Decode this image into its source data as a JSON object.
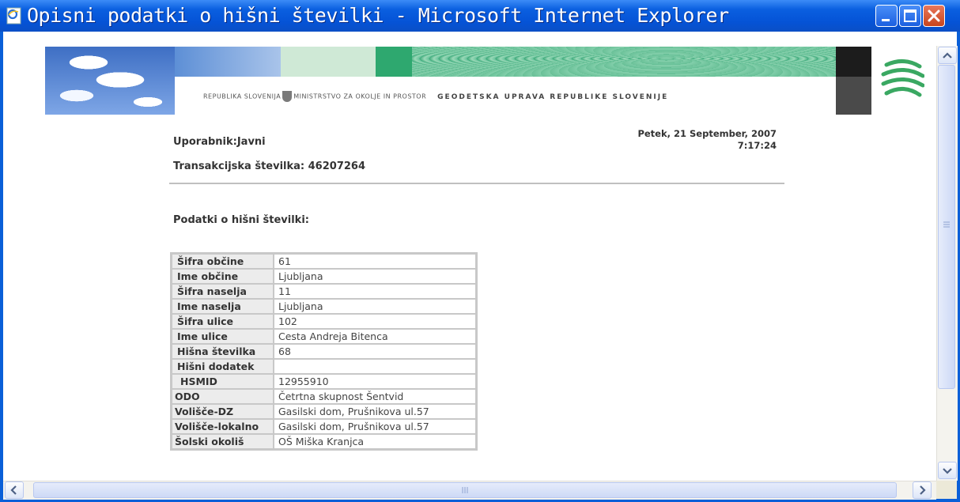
{
  "window": {
    "title": "Opisni podatki o hišni številki - Microsoft Internet Explorer",
    "buttons": [
      "minimize",
      "maximize",
      "close"
    ]
  },
  "header": {
    "banner_text_left": "REPUBLIKA SLOVENIJA",
    "banner_text_mid": "MINISTRSTVO ZA OKOLJE IN PROSTOR",
    "banner_text_right": "GEODETSKA UPRAVA REPUBLIKE SLOVENIJE"
  },
  "info": {
    "user": "Uporabnik:Javni",
    "transaction": "Transakcijska številka: 46207264",
    "date": "Petek, 21 September, 2007",
    "time": "7:17:24",
    "section_title": "Podatki o hišni številki:"
  },
  "table": {
    "rows": [
      {
        "key": "Šifra občine",
        "value": "61"
      },
      {
        "key": "Ime občine",
        "value": "Ljubljana"
      },
      {
        "key": "Šifra naselja",
        "value": "11"
      },
      {
        "key": "Ime naselja",
        "value": "Ljubljana"
      },
      {
        "key": "Šifra ulice",
        "value": "102"
      },
      {
        "key": "Ime ulice",
        "value": "Cesta Andreja Bitenca"
      },
      {
        "key": "Hišna številka",
        "value": "68"
      },
      {
        "key": "Hišni dodatek",
        "value": ""
      },
      {
        "key": "HSMID",
        "value": "12955910"
      },
      {
        "key": "ODO",
        "value": "Četrtna skupnost Šentvid"
      },
      {
        "key": "Volišče-DZ",
        "value": "Gasilski dom, Prušnikova ul.57"
      },
      {
        "key": "Volišče-lokalno",
        "value": "Gasilski dom, Prušnikova ul.57"
      },
      {
        "key": "Šolski okoliš",
        "value": "OŠ Miška Kranjca"
      }
    ]
  },
  "colors": {
    "titlebar": "#0553d6",
    "close_button": "#c8451d",
    "label_cell_bg": "#ececec",
    "logo_green": "#3aa862"
  },
  "icons": [
    "ie-page-icon",
    "minimize-icon",
    "maximize-icon",
    "close-icon",
    "scroll-up-icon",
    "scroll-down-icon",
    "scroll-left-icon",
    "scroll-right-icon",
    "gurs-logo"
  ]
}
